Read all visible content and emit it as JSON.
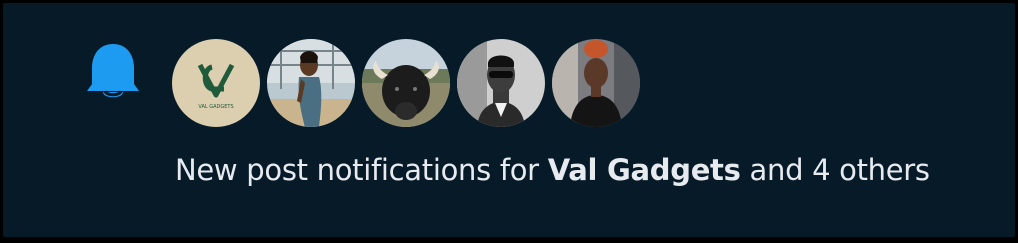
{
  "notification": {
    "icon": "bell-icon",
    "accent_color": "#1d9bf0",
    "avatars": [
      {
        "name": "val-gadgets-logo-avatar",
        "logo_text": "VAL GADGETS"
      },
      {
        "name": "user-avatar-2"
      },
      {
        "name": "user-avatar-3"
      },
      {
        "name": "user-avatar-4"
      },
      {
        "name": "user-avatar-5"
      }
    ],
    "message_prefix": "New post notifications for ",
    "account_name": "Val Gadgets",
    "message_suffix": " and 4 others"
  }
}
